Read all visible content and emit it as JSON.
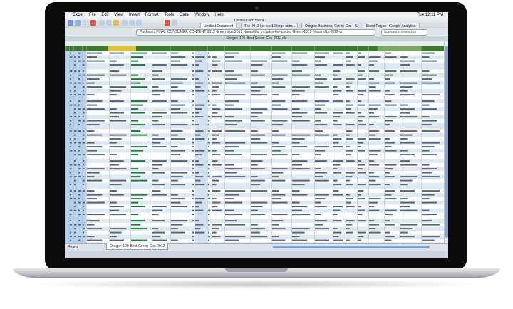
{
  "menubar": {
    "apple": "",
    "app": "Excel",
    "items": [
      "File",
      "Edit",
      "View",
      "Insert",
      "Format",
      "Tools",
      "Data",
      "Window",
      "Help"
    ],
    "clock": "Tue 12:11 PM"
  },
  "window": {
    "title": "Untitled Document",
    "filename": "Oregon-100-Best-Green-Cos-2012.xls"
  },
  "tabs": [
    {
      "label": "Untitled Document",
      "active": true
    },
    {
      "label": "The 2012 list top 10 large com...",
      "active": false
    },
    {
      "label": "Oregon Business: Green Cos - Sales...",
      "active": false
    },
    {
      "label": "Event Pages - Google Analytics",
      "active": false
    }
  ],
  "browser": {
    "url": "Packages FINAL CONSUMER CONTENT 2012 Green plus 2012 Nonprofits Includes-for-articles Green-2012-Nonprofits-2012-pt",
    "search_value": "rounded corners css"
  },
  "status": {
    "ready": "Ready",
    "sheet_tab": "Oregon-100-Best-Green-Cos-2012"
  },
  "colors": {
    "header_green": "#3d7a2e",
    "header_gold": "#d9c33a",
    "highlight_blue": "#b8d2ec",
    "row_alt": "#dfe9f4",
    "link_green": "#1f7a3a"
  }
}
